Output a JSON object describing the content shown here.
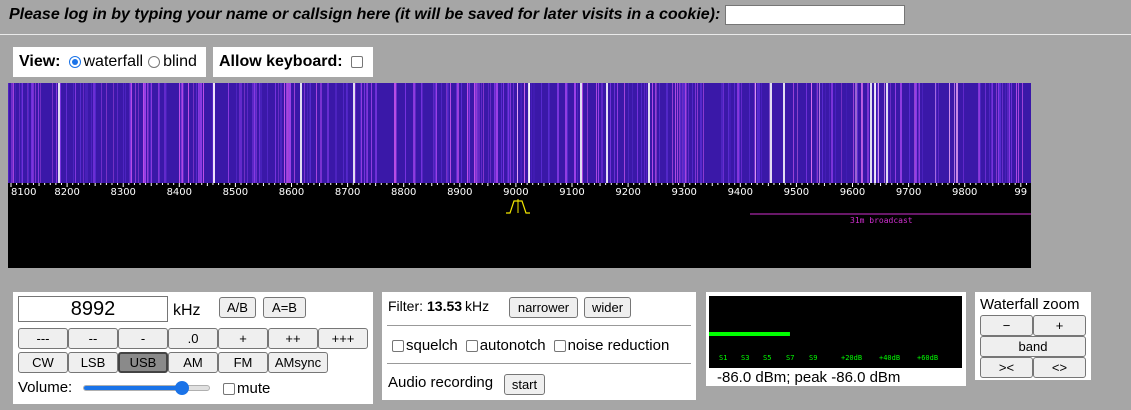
{
  "login": {
    "label": "Please log in by typing your name or callsign here (it will be saved for later visits in a cookie):",
    "value": ""
  },
  "view": {
    "label": "View:",
    "options": [
      "waterfall",
      "blind"
    ],
    "selected": "waterfall"
  },
  "keyboard": {
    "label": "Allow keyboard:",
    "checked": false
  },
  "spectrum": {
    "scale_labels": [
      "8100",
      "8200",
      "8300",
      "8400",
      "8500",
      "8600",
      "8700",
      "8800",
      "8900",
      "9000",
      "9100",
      "9200",
      "9300",
      "9400",
      "9500",
      "9600",
      "9700",
      "9800",
      "99"
    ],
    "band_label": "31m broadcast",
    "tuned_khz": 8992
  },
  "tuning": {
    "frequency": "8992",
    "unit": "kHz",
    "ab_label": "A/B",
    "aeqb_label": "A=B",
    "step_labels": [
      "---",
      "--",
      "-",
      ".0",
      "+",
      "++",
      "+++"
    ],
    "mode_labels": [
      "CW",
      "LSB",
      "USB",
      "AM",
      "FM",
      "AMsync"
    ],
    "selected_mode": "USB",
    "volume_label": "Volume:",
    "volume_level": 0.77,
    "mute_label": "mute",
    "mute_checked": false
  },
  "filter": {
    "label": "Filter:",
    "value": "13.53",
    "unit": "kHz",
    "narrower_label": "narrower",
    "wider_label": "wider",
    "options": [
      "squelch",
      "autonotch",
      "noise reduction"
    ],
    "audio_label": "Audio recording",
    "start_label": "start"
  },
  "smeter": {
    "scale_labels": [
      "S1",
      "S3",
      "S5",
      "S7",
      "S9",
      "+20dB",
      "+40dB",
      "+60dB"
    ],
    "readout": "-86.0 dBm; peak  -86.0 dBm",
    "level": 0.32,
    "bar_color": "#00ff00"
  },
  "zoom": {
    "title": "Waterfall zoom",
    "minus_label": "−",
    "plus_label": "+",
    "band_label": "band",
    "left_label": "><",
    "right_label": "<>"
  },
  "colors": {
    "background": "#a6a6a6",
    "waterfall_base": "#3a18a8",
    "band_marker": "#d12fd1",
    "passband": "#f2e600",
    "accent": "#1a73e8"
  }
}
